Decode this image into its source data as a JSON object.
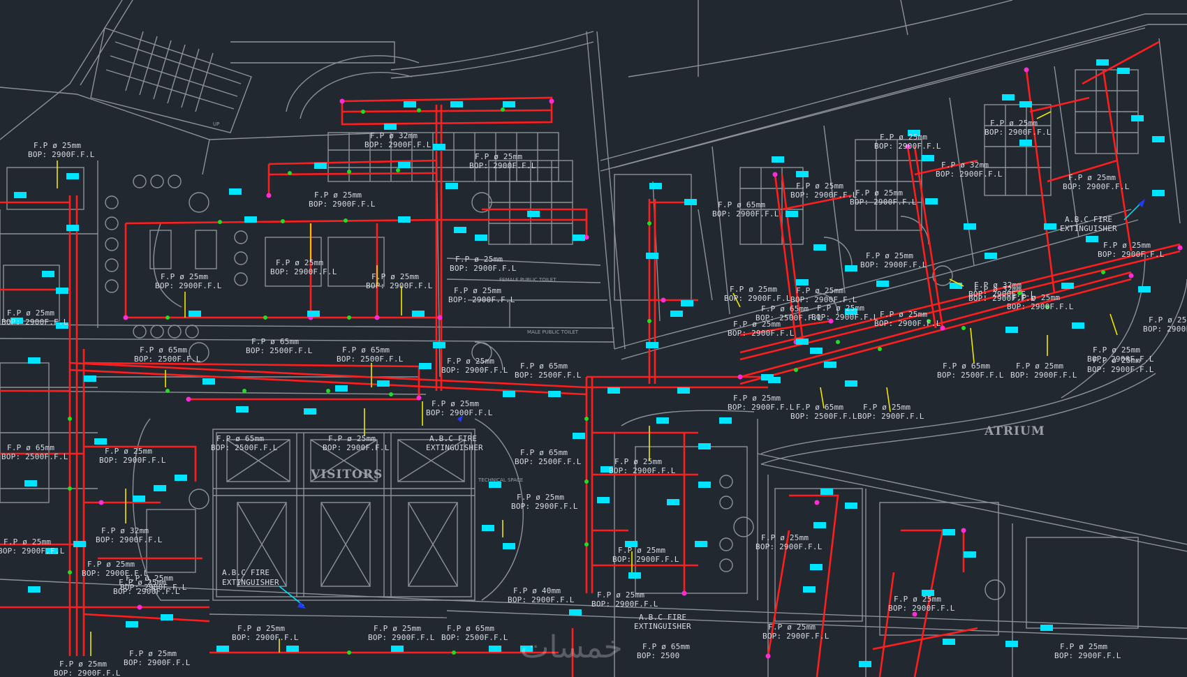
{
  "rooms": {
    "visitors": "VISITORS",
    "atrium": "ATRIUM",
    "fire_extinguisher_1": "A.B.C FIRE",
    "fire_extinguisher_1b": "EXTINGUISHER",
    "fire_extinguisher_2": "A.B.C FIRE",
    "fire_extinguisher_2b": "EXTINGUISHER",
    "fire_extinguisher_3": "A.B.C FIRE",
    "fire_extinguisher_3b": "EXTINGUISHER",
    "fire_extinguisher_4": "A.B.C FIRE",
    "fire_extinguisher_4b": "EXTINGUISHER",
    "female_toilet": "FEMALE PUBLIC TOILET",
    "male_toilet": "MALE PUBLIC TOILET",
    "technical_space": "TECHNICAL SPACE",
    "up": "UP"
  },
  "pipe_labels": [
    {
      "size": "F.P ø 25mm",
      "bop": "BOP: 2900F.F.L"
    },
    {
      "size": "F.P ø 32mm",
      "bop": "BOP: 2900F.F.L"
    },
    {
      "size": "F.P ø 25mm",
      "bop": "BOP: 2900F.F.L"
    },
    {
      "size": "F.P ø 25mm",
      "bop": "BOP: 2900F.F.L"
    },
    {
      "size": "F.P ø 25mm",
      "bop": "BOP: 2900F.F.L"
    },
    {
      "size": "F.P ø 32mm",
      "bop": "BOP: 2900F.F.L"
    },
    {
      "size": "F.P ø 25mm",
      "bop": "BOP: 2900F.F.L"
    },
    {
      "size": "F.P ø 65mm",
      "bop": "BOP: 2500F.F.L"
    },
    {
      "size": "F.P ø 65mm",
      "bop": "BOP: 2500F.F.L"
    },
    {
      "size": "F.P ø 25mm",
      "bop": "BOP: 2900F.F.L"
    },
    {
      "size": "F.P ø 65mm",
      "bop": "BOP: 2500F.F.L"
    },
    {
      "size": "F.P ø 65mm",
      "bop": "BOP: 2900F.F.L"
    },
    {
      "size": "F.P ø 25mm",
      "bop": "BOP: 2900F.F.L"
    },
    {
      "size": "F.P ø 25mm",
      "bop": "BOP: 2900F.F.L"
    },
    {
      "size": "F.P ø 25mm",
      "bop": "BOP: 2900F.F.L"
    },
    {
      "size": "F.P ø 25mm",
      "bop": "BOP: 2900F.F.L"
    },
    {
      "size": "F.P ø 25mm",
      "bop": "BOP: 2900F.F.L"
    },
    {
      "size": "F.P ø 65mm",
      "bop": "BOP: 2500F.F.L"
    },
    {
      "size": "F.P ø 25mm",
      "bop": "BOP: 2900F.F.L"
    },
    {
      "size": "F.P ø 25mm",
      "bop": "BOP: 2900F.F.L"
    },
    {
      "size": "F.P ø 32mm",
      "bop": "BOP: 2900F.F.L"
    },
    {
      "size": "F.P ø 25mm",
      "bop": "BOP: 2900F.F.L"
    },
    {
      "size": "F.P ø 25mm",
      "bop": "BOP: 2900F.F.L"
    },
    {
      "size": "F.P ø 25mm",
      "bop": "BOP: 2900F.F.L"
    },
    {
      "size": "F.P ø 25mm",
      "bop": "BOP: 2900F.F.L"
    },
    {
      "size": "F.P ø 65mm",
      "bop": "BOP: 2500F.F.L"
    },
    {
      "size": "F.P ø 25mm",
      "bop": "BOP: 2900F.F.L"
    },
    {
      "size": "F.P ø 25mm",
      "bop": "BOP: 2900F.F.L"
    },
    {
      "size": "F.P ø 65mm",
      "bop": "BOP: 2500F.F.L"
    },
    {
      "size": "F.P ø 25mm",
      "bop": "BOP: 2900F.F.L"
    },
    {
      "size": "F.P ø 25mm",
      "bop": "BOP: 2900F.F.L"
    },
    {
      "size": "F.P ø 65mm",
      "bop": "BOP: 2500F.F.L"
    },
    {
      "size": "F.P ø 65mm",
      "bop": "BOP: 2500F.F.L"
    },
    {
      "size": "F.P ø 25mm",
      "bop": "BOP: 2900F.F.L"
    },
    {
      "size": "F.P ø 25mm",
      "bop": "BOP: 2900F.F.L"
    },
    {
      "size": "F.P ø 65mm",
      "bop": "BOP: 2500F.F.L"
    },
    {
      "size": "F.P ø 25mm",
      "bop": "BOP: 2900F.F.L"
    },
    {
      "size": "F.P ø 25mm",
      "bop": "BOP: 2900F.F.L"
    },
    {
      "size": "F.P ø 25mm",
      "bop": "BOP: 2900F.F.L"
    },
    {
      "size": "F.P ø 25mm",
      "bop": "BOP: 2900F.F.L"
    },
    {
      "size": "F.P ø 40mm",
      "bop": "BOP: 2900F.F.L"
    },
    {
      "size": "F.P ø 65mm",
      "bop": "BOP: 2500"
    },
    {
      "size": "F.P ø 25mm",
      "bop": "BOP: 2900F.F.L"
    },
    {
      "size": "F.P ø 25mm",
      "bop": "BOP: 2900F.F.L"
    },
    {
      "size": "F.P ø 25mm",
      "bop": "BOP: 2900F.F.L"
    },
    {
      "size": "F.P ø 65mm",
      "bop": "BOP: 2500F.F.L"
    },
    {
      "size": "F.P ø 25mm",
      "bop": "BOP: 2900F.F.L"
    },
    {
      "size": "F.P ø 25mm",
      "bop": "BOP: 2900F.F.L"
    },
    {
      "size": "F.P ø 25mm",
      "bop": "BOP: 2900F.F.L"
    },
    {
      "size": "F.P ø 25mm",
      "bop": "BOP: 2900F.F.L"
    },
    {
      "size": "F.P ø 25mm",
      "bop": "BOP: 2900F.F.L"
    },
    {
      "size": "F.P ø 25mm",
      "bop": "BOP: 2900F.F.L"
    },
    {
      "size": "F.P ø 25mm",
      "bop": "BOP: 2900F.F.L"
    },
    {
      "size": "F.P ø 32mm",
      "bop": "BOP: 2900F.F.L"
    },
    {
      "size": "F.P ø 25mm",
      "bop": "BOP: 2900F.F.L"
    },
    {
      "size": "F.P ø 25mm",
      "bop": "BOP: 2900F.F.L"
    },
    {
      "size": "F.P ø 32mm",
      "bop": "BOP: 2900F.F.L"
    },
    {
      "size": "F.P ø 65mm",
      "bop": "BOP: 2500F.F.L"
    },
    {
      "size": "F.P ø 25mm",
      "bop": "BOP: 2900F.F.L"
    },
    {
      "size": "F.P ø 25mm",
      "bop": "BOP: 2900F.F.L"
    },
    {
      "size": "F.P ø 25mm",
      "bop": "BOP: 2900F.F.L"
    },
    {
      "size": "F.P ø 25mm",
      "bop": "BOP: 2900F.F.L"
    },
    {
      "size": "F.P ø 25mm",
      "bop": "BOP: 2900F.F.L"
    },
    {
      "size": "F.P ø 25mm",
      "bop": "BOP: 2900F.F.L"
    },
    {
      "size": "F.P ø 25mm",
      "bop": "BOP: 2900F.F.L"
    },
    {
      "size": "F.P ø 25mm",
      "bop": "BOP: 2900F.F.L"
    },
    {
      "size": "F.P ø 25mm",
      "bop": "BOP: 2900F.F.L"
    }
  ],
  "watermark": "خمسات",
  "colors": {
    "background": "#212830",
    "walls": "#8c9298",
    "pipe": "#ff1e1e",
    "sprinkler_tag": "#00e5ff",
    "leader": "#f2e600",
    "node": "#ff2bd6",
    "valve": "#22dd22"
  }
}
